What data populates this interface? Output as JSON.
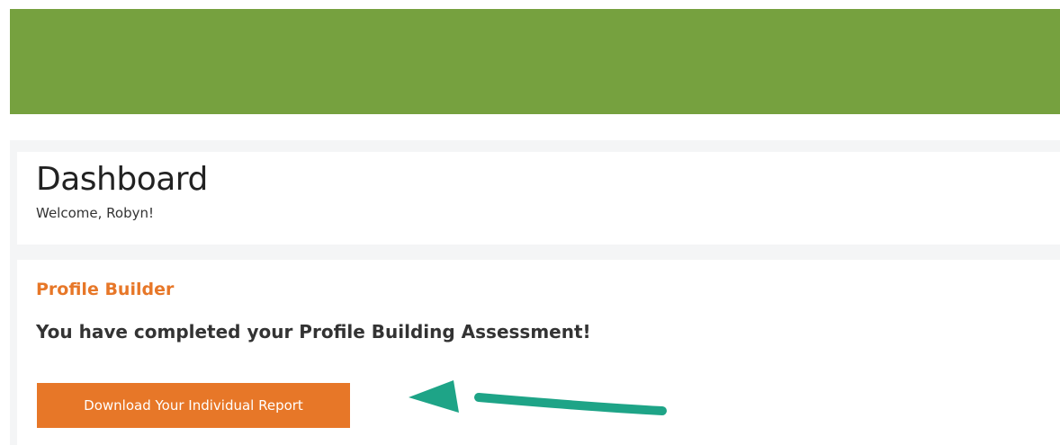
{
  "header": {
    "banner_color": "#76a13f"
  },
  "dashboard": {
    "title": "Dashboard",
    "welcome": "Welcome, Robyn!"
  },
  "profile_builder": {
    "title": "Profile Builder",
    "message": "You have completed your Profile Building Assessment!",
    "download_label": "Download Your Individual Report"
  },
  "annotation": {
    "arrow_icon": "arrow-left-icon",
    "arrow_color": "#1ea487"
  },
  "colors": {
    "accent": "#e77728",
    "background": "#f4f5f6",
    "text": "#333333"
  }
}
